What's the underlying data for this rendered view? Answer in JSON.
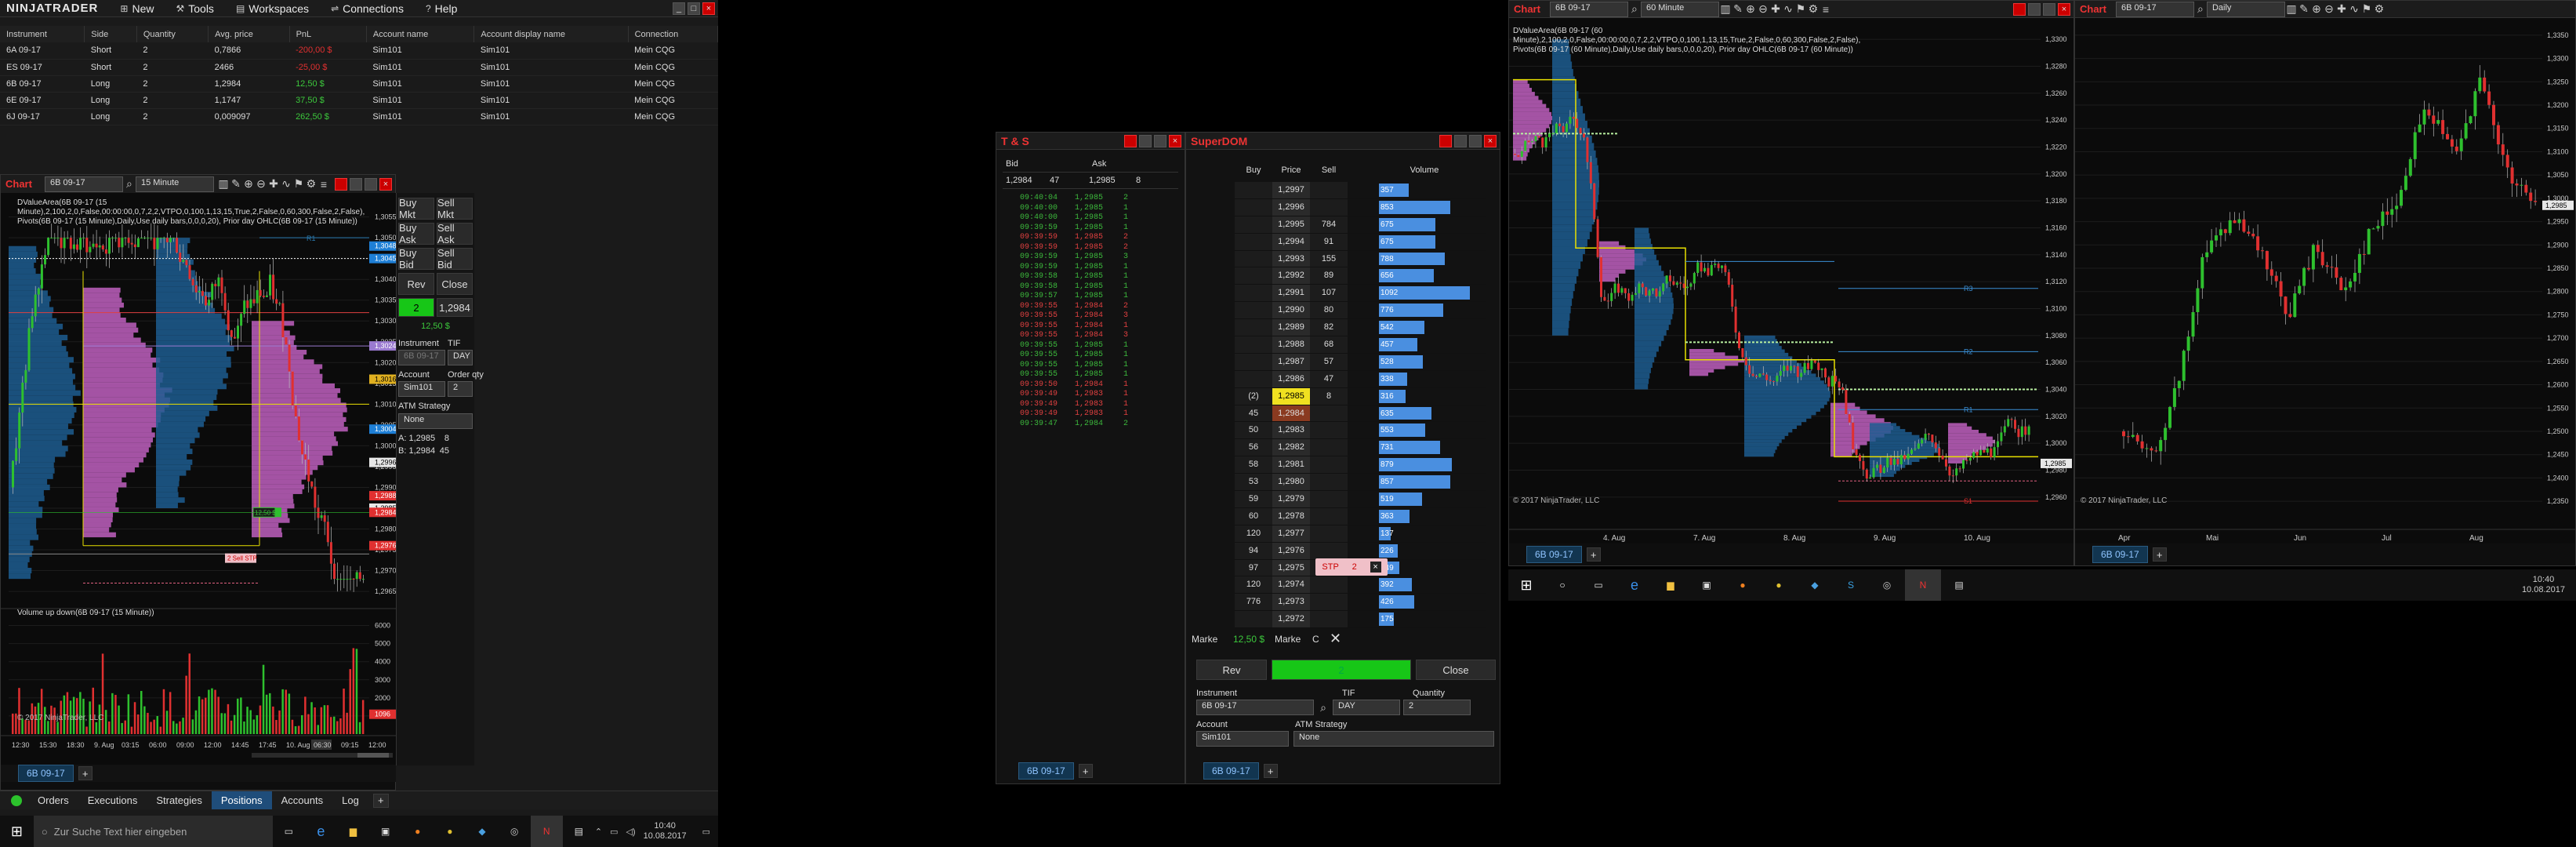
{
  "app": {
    "logo": "NINJATRADER",
    "menu": [
      {
        "label": "New",
        "icon": "new-icon"
      },
      {
        "label": "Tools",
        "icon": "tools-icon"
      },
      {
        "label": "Workspaces",
        "icon": "workspaces-icon"
      },
      {
        "label": "Connections",
        "icon": "connections-icon"
      },
      {
        "label": "Help",
        "icon": "help-icon"
      }
    ]
  },
  "positions": {
    "headers": [
      "Instrument",
      "Side",
      "Quantity",
      "Avg. price",
      "PnL",
      "Account name",
      "Account display name",
      "Connection"
    ],
    "rows": [
      [
        "6A 09-17",
        "Short",
        "2",
        "0,7866",
        "-200,00 $",
        "Sim101",
        "Sim101",
        "Mein CQG"
      ],
      [
        "ES 09-17",
        "Short",
        "2",
        "2466",
        "-25,00 $",
        "Sim101",
        "Sim101",
        "Mein CQG"
      ],
      [
        "6B 09-17",
        "Long",
        "2",
        "1,2984",
        "12,50 $",
        "Sim101",
        "Sim101",
        "Mein CQG"
      ],
      [
        "6E 09-17",
        "Long",
        "2",
        "1,1747",
        "37,50 $",
        "Sim101",
        "Sim101",
        "Mein CQG"
      ],
      [
        "6J 09-17",
        "Long",
        "2",
        "0,009097",
        "262,50 $",
        "Sim101",
        "Sim101",
        "Mein CQG"
      ]
    ],
    "pnl_colors": [
      "#e03030",
      "#e03030",
      "#3cc83c",
      "#3cc83c",
      "#3cc83c"
    ]
  },
  "chart1": {
    "title": "Chart",
    "instrument": "6B 09-17",
    "interval": "15 Minute",
    "info": "DValueArea(6B 09-17 (15 Minute),2,100,2,0,False,00:00:00,0,7,2,2,VTPO,0,100,1,13,15,True,2,False,0,60,300,False,2,False), Pivots(6B 09-17 (15 Minute),Daily,Use daily bars,0,0,0,20), Prior day OHLC(6B 09-17 (15 Minute))",
    "y_ticks": [
      "1,3055",
      "1,3050",
      "1,3045",
      "1,3040",
      "1,3035",
      "1,3030",
      "1,3025",
      "1,3020",
      "1,3015",
      "1,3010",
      "1,3005",
      "1,3000",
      "1,2995",
      "1,2990",
      "1,2985",
      "1,2980",
      "1,2975",
      "1,2970",
      "1,2965"
    ],
    "badges": [
      {
        "label": "1,3048",
        "color": "#1e7fd6"
      },
      {
        "label": "1,3045",
        "color": "#1e7fd6"
      },
      {
        "label": "1,3024",
        "color": "#9a7ad0"
      },
      {
        "label": "1,3016",
        "color": "#e0b020"
      },
      {
        "label": "1,3004",
        "color": "#1e7fd6"
      },
      {
        "label": "1,2996",
        "color": "#e8e8e8"
      },
      {
        "label": "1,2988",
        "color": "#e03030"
      },
      {
        "label": "1,2985",
        "color": "#e8e8e8"
      },
      {
        "label": "1,2984",
        "color": "#e03030"
      },
      {
        "label": "1,2976",
        "color": "#e03030"
      }
    ],
    "order_label": "1,2984",
    "pnl_label": "12,50 $",
    "stop_label": "2 Sell STP",
    "r1": "R1",
    "vol_title": "Volume up down(6B 09-17 (15 Minute))",
    "vol_ticks": [
      "6000",
      "5000",
      "4000",
      "3000",
      "2000",
      "1000"
    ],
    "vol_badge": "1096",
    "x_ticks": [
      "12:30",
      "15:30",
      "18:30",
      "9. Aug",
      "03:15",
      "06:00",
      "09:00",
      "12:00",
      "14:45",
      "17:45",
      "10. Aug",
      "06:30",
      "09:15",
      "12:00"
    ],
    "x_highlight": "06:30",
    "copyright": "© 2017 NinjaTrader, LLC",
    "tab": "6B 09-17"
  },
  "chart_trader": {
    "buy_mkt": "Buy Mkt",
    "sell_mkt": "Sell Mkt",
    "buy_ask": "Buy Ask",
    "sell_ask": "Sell Ask",
    "buy_bid": "Buy Bid",
    "sell_bid": "Sell Bid",
    "rev": "Rev",
    "close": "Close",
    "position": "2",
    "price": "1,2984",
    "pnl": "12,50 $",
    "instrument_label": "Instrument",
    "tif_label": "TIF",
    "instrument": "6B 09-17",
    "tif": "DAY",
    "account_label": "Account",
    "qty_label": "Order qty",
    "account": "Sim101",
    "qty": "2",
    "atm_label": "ATM Strategy",
    "atm": "None",
    "ask_line": "A: 1,2985",
    "ask_size": "8",
    "bid_line": "B: 1,2984",
    "bid_size": "45"
  },
  "ts": {
    "title": "T & S",
    "bid_h": "Bid",
    "ask_h": "Ask",
    "bid": "1,2984",
    "bid_size": "47",
    "ask": "1,2985",
    "ask_size": "8",
    "rows": [
      [
        "09:40:04",
        "1,2985",
        "2",
        "g"
      ],
      [
        "09:40:00",
        "1,2985",
        "1",
        "g"
      ],
      [
        "09:40:00",
        "1,2985",
        "1",
        "g"
      ],
      [
        "09:39:59",
        "1,2985",
        "1",
        "g"
      ],
      [
        "09:39:59",
        "1,2985",
        "2",
        "r"
      ],
      [
        "09:39:59",
        "1,2985",
        "2",
        "r"
      ],
      [
        "09:39:59",
        "1,2985",
        "3",
        "g"
      ],
      [
        "09:39:59",
        "1,2985",
        "1",
        "g"
      ],
      [
        "09:39:58",
        "1,2985",
        "1",
        "g"
      ],
      [
        "09:39:58",
        "1,2985",
        "1",
        "g"
      ],
      [
        "09:39:57",
        "1,2985",
        "1",
        "g"
      ],
      [
        "09:39:55",
        "1,2984",
        "2",
        "r"
      ],
      [
        "09:39:55",
        "1,2984",
        "3",
        "r"
      ],
      [
        "09:39:55",
        "1,2984",
        "1",
        "r"
      ],
      [
        "09:39:55",
        "1,2984",
        "3",
        "r"
      ],
      [
        "09:39:55",
        "1,2985",
        "1",
        "g"
      ],
      [
        "09:39:55",
        "1,2985",
        "1",
        "g"
      ],
      [
        "09:39:55",
        "1,2985",
        "1",
        "g"
      ],
      [
        "09:39:55",
        "1,2985",
        "1",
        "g"
      ],
      [
        "09:39:50",
        "1,2984",
        "1",
        "r"
      ],
      [
        "09:39:49",
        "1,2983",
        "1",
        "r"
      ],
      [
        "09:39:49",
        "1,2983",
        "1",
        "r"
      ],
      [
        "09:39:49",
        "1,2983",
        "1",
        "r"
      ],
      [
        "09:39:47",
        "1,2984",
        "2",
        "g"
      ]
    ],
    "tab": "6B 09-17"
  },
  "dom": {
    "title": "SuperDOM",
    "buy_h": "Buy",
    "price_h": "Price",
    "sell_h": "Sell",
    "volume_h": "Volume",
    "rows": [
      [
        "",
        "1,2997",
        "",
        "357"
      ],
      [
        "",
        "1,2996",
        "",
        "853"
      ],
      [
        "",
        "1,2995",
        "784",
        "675"
      ],
      [
        "",
        "1,2994",
        "91",
        "675"
      ],
      [
        "",
        "1,2993",
        "155",
        "788"
      ],
      [
        "",
        "1,2992",
        "89",
        "656"
      ],
      [
        "",
        "1,2991",
        "107",
        "1092"
      ],
      [
        "",
        "1,2990",
        "80",
        "776"
      ],
      [
        "",
        "1,2989",
        "82",
        "542"
      ],
      [
        "",
        "1,2988",
        "68",
        "457"
      ],
      [
        "",
        "1,2987",
        "57",
        "528"
      ],
      [
        "",
        "1,2986",
        "47",
        "338"
      ],
      [
        "(2)",
        "1,2985",
        "8",
        "316"
      ],
      [
        "45",
        "1,2984",
        "",
        "635"
      ],
      [
        "50",
        "1,2983",
        "",
        "553"
      ],
      [
        "56",
        "1,2982",
        "",
        "731"
      ],
      [
        "58",
        "1,2981",
        "",
        "879"
      ],
      [
        "53",
        "1,2980",
        "",
        "857"
      ],
      [
        "59",
        "1,2979",
        "",
        "519"
      ],
      [
        "60",
        "1,2978",
        "",
        "363"
      ],
      [
        "120",
        "1,2977",
        "",
        "137"
      ],
      [
        "94",
        "1,2976",
        "",
        "226"
      ],
      [
        "97",
        "1,2975",
        "",
        "249"
      ],
      [
        "120",
        "1,2974",
        "",
        "392"
      ],
      [
        "776",
        "1,2973",
        "",
        "426"
      ],
      [
        "",
        "1,2972",
        "",
        "175"
      ]
    ],
    "stp": "STP",
    "stp_qty": "2",
    "market": "Marke",
    "pnl": "12,50 $",
    "market2": "Marke",
    "c": "C",
    "rev": "Rev",
    "position": "2",
    "close": "Close",
    "instrument_label": "Instrument",
    "tif_label": "TIF",
    "qty_label": "Quantity",
    "instrument": "6B 09-17",
    "tif": "DAY",
    "qty": "2",
    "account_label": "Account",
    "atm_label": "ATM Strategy",
    "account": "Sim101",
    "atm": "None",
    "tab": "6B 09-17"
  },
  "chart2": {
    "title": "Chart",
    "instrument": "6B 09-17",
    "interval": "60 Minute",
    "info": "DValueArea(6B 09-17 (60 Minute),2,100,2,0,False,00:00:00,0,7,2,2,VTPO,0,100,1,13,15,True,2,False,0,60,300,False,2,False), Pivots(6B 09-17 (60 Minute),Daily,Use daily bars,0,0,0,20), Prior day OHLC(6B 09-17 (60 Minute))",
    "y_ticks": [
      "1,3300",
      "1,3280",
      "1,3260",
      "1,3240",
      "1,3220",
      "1,3200",
      "1,3180",
      "1,3160",
      "1,3140",
      "1,3120",
      "1,3100",
      "1,3080",
      "1,3060",
      "1,3040",
      "1,3020",
      "1,3000",
      "1,2980",
      "1,2960"
    ],
    "x_ticks": [
      "4. Aug",
      "7. Aug",
      "8. Aug",
      "9. Aug",
      "10. Aug"
    ],
    "badge": "1,2985",
    "r3": "R3",
    "r2": "R2",
    "r1": "R1",
    "s1": "S1",
    "copyright": "© 2017 NinjaTrader, LLC",
    "tab": "6B 09-17"
  },
  "chart3": {
    "title": "Chart",
    "instrument": "6B 09-17",
    "interval": "Daily",
    "y_ticks": [
      "1,3350",
      "1,3300",
      "1,3250",
      "1,3200",
      "1,3150",
      "1,3100",
      "1,3050",
      "1,3000",
      "1,2950",
      "1,2900",
      "1,2850",
      "1,2800",
      "1,2750",
      "1,2700",
      "1,2650",
      "1,2600",
      "1,2550",
      "1,2500",
      "1,2450",
      "1,2400",
      "1,2350"
    ],
    "x_ticks": [
      "Apr",
      "Mai",
      "Jun",
      "Jul",
      "Aug"
    ],
    "badge": "1,2985",
    "copyright": "© 2017 NinjaTrader, LLC",
    "tab": "6B 09-17"
  },
  "control_tabs": [
    "Orders",
    "Executions",
    "Strategies",
    "Positions",
    "Accounts",
    "Log"
  ],
  "active_control_tab": "Positions",
  "taskbar_left": {
    "search_placeholder": "Zur Suche Text hier eingeben",
    "time": "10:40",
    "date": "10.08.2017"
  },
  "taskbar_right": {
    "time": "10:40",
    "date": "10.08.2017"
  }
}
